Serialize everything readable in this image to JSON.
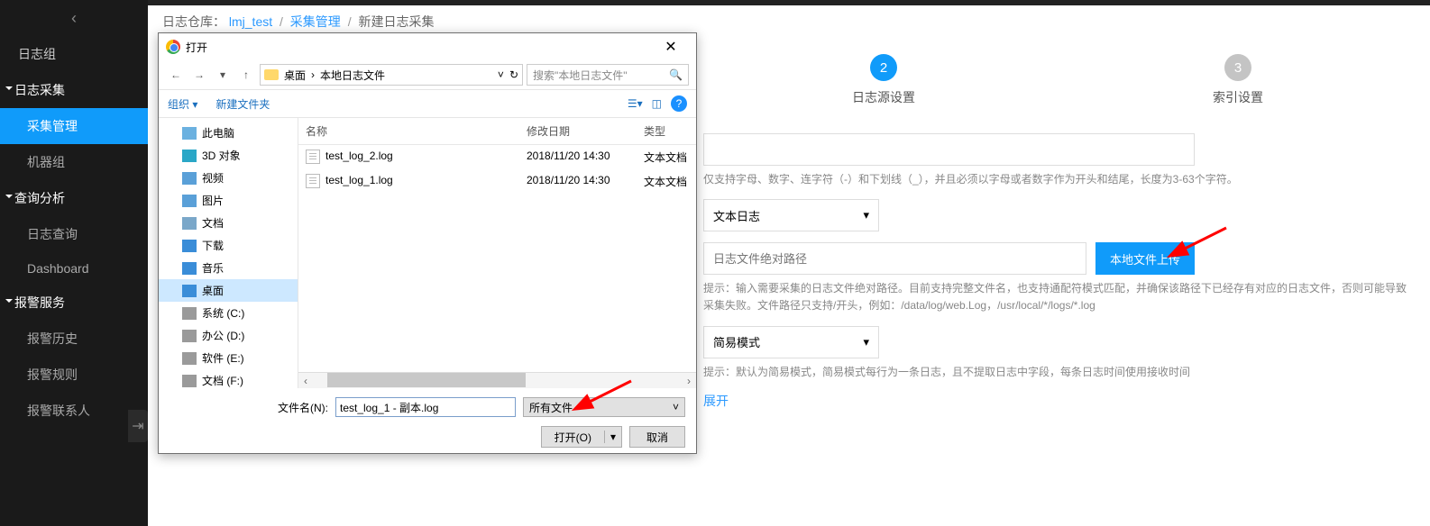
{
  "sidebar": {
    "items": [
      {
        "label": "日志组",
        "type": "item"
      },
      {
        "label": "日志采集",
        "type": "group"
      },
      {
        "label": "采集管理",
        "type": "sub",
        "active": true
      },
      {
        "label": "机器组",
        "type": "sub"
      },
      {
        "label": "查询分析",
        "type": "group"
      },
      {
        "label": "日志查询",
        "type": "sub"
      },
      {
        "label": "Dashboard",
        "type": "sub"
      },
      {
        "label": "报警服务",
        "type": "group"
      },
      {
        "label": "报警历史",
        "type": "sub"
      },
      {
        "label": "报警规则",
        "type": "sub"
      },
      {
        "label": "报警联系人",
        "type": "sub"
      }
    ]
  },
  "breadcrumb": {
    "prefix": "日志仓库：",
    "repo": "lmj_test",
    "mid": "采集管理",
    "last": "新建日志采集"
  },
  "steps": [
    {
      "num": "2",
      "label": "日志源设置",
      "active": true
    },
    {
      "num": "3",
      "label": "索引设置",
      "active": false
    }
  ],
  "form": {
    "name_placeholder": "",
    "name_help": "仅支持字母、数字、连字符（-）和下划线（_），并且必须以字母或者数字作为开头和结尾，长度为3-63个字符。",
    "type_value": "文本日志",
    "path_placeholder": "日志文件绝对路径",
    "upload_label": "本地文件上传",
    "path_help": "提示：输入需要采集的日志文件绝对路径。目前支持完整文件名，也支持通配符模式匹配，并确保该路径下已经存有对应的日志文件，否则可能导致采集失败。文件路径只支持/开头，例如：/data/log/web.Log，/usr/local/*/logs/*.log",
    "mode_value": "简易模式",
    "mode_help": "提示：默认为简易模式，简易模式每行为一条日志，且不提取日志中字段，每条日志时间使用接收时间",
    "expand": "展开"
  },
  "dialog": {
    "title": "打开",
    "path_segments": [
      "桌面",
      "本地日志文件"
    ],
    "refresh_tip": "↻",
    "search_placeholder": "搜索\"本地日志文件\"",
    "toolbar": {
      "organize": "组织",
      "newfolder": "新建文件夹"
    },
    "tree": [
      {
        "label": "此电脑",
        "cls": "ico-pc"
      },
      {
        "label": "3D 对象",
        "cls": "ico-3d"
      },
      {
        "label": "视频",
        "cls": "ico-vid"
      },
      {
        "label": "图片",
        "cls": "ico-pic"
      },
      {
        "label": "文档",
        "cls": "ico-doc"
      },
      {
        "label": "下载",
        "cls": "ico-dl"
      },
      {
        "label": "音乐",
        "cls": "ico-music"
      },
      {
        "label": "桌面",
        "cls": "ico-desk",
        "sel": true
      },
      {
        "label": "系统 (C:)",
        "cls": "ico-drive"
      },
      {
        "label": "办公 (D:)",
        "cls": "ico-drive"
      },
      {
        "label": "软件 (E:)",
        "cls": "ico-drive"
      },
      {
        "label": "文档 (F:)",
        "cls": "ico-drive"
      }
    ],
    "columns": {
      "name": "名称",
      "date": "修改日期",
      "type": "类型"
    },
    "files": [
      {
        "name": "test_log_2.log",
        "date": "2018/11/20 14:30",
        "type": "文本文档"
      },
      {
        "name": "test_log_1.log",
        "date": "2018/11/20 14:30",
        "type": "文本文档"
      }
    ],
    "fn_label": "文件名(N):",
    "fn_value": "test_log_1 - 副本.log",
    "filter": "所有文件",
    "open": "打开(O)",
    "cancel": "取消"
  }
}
